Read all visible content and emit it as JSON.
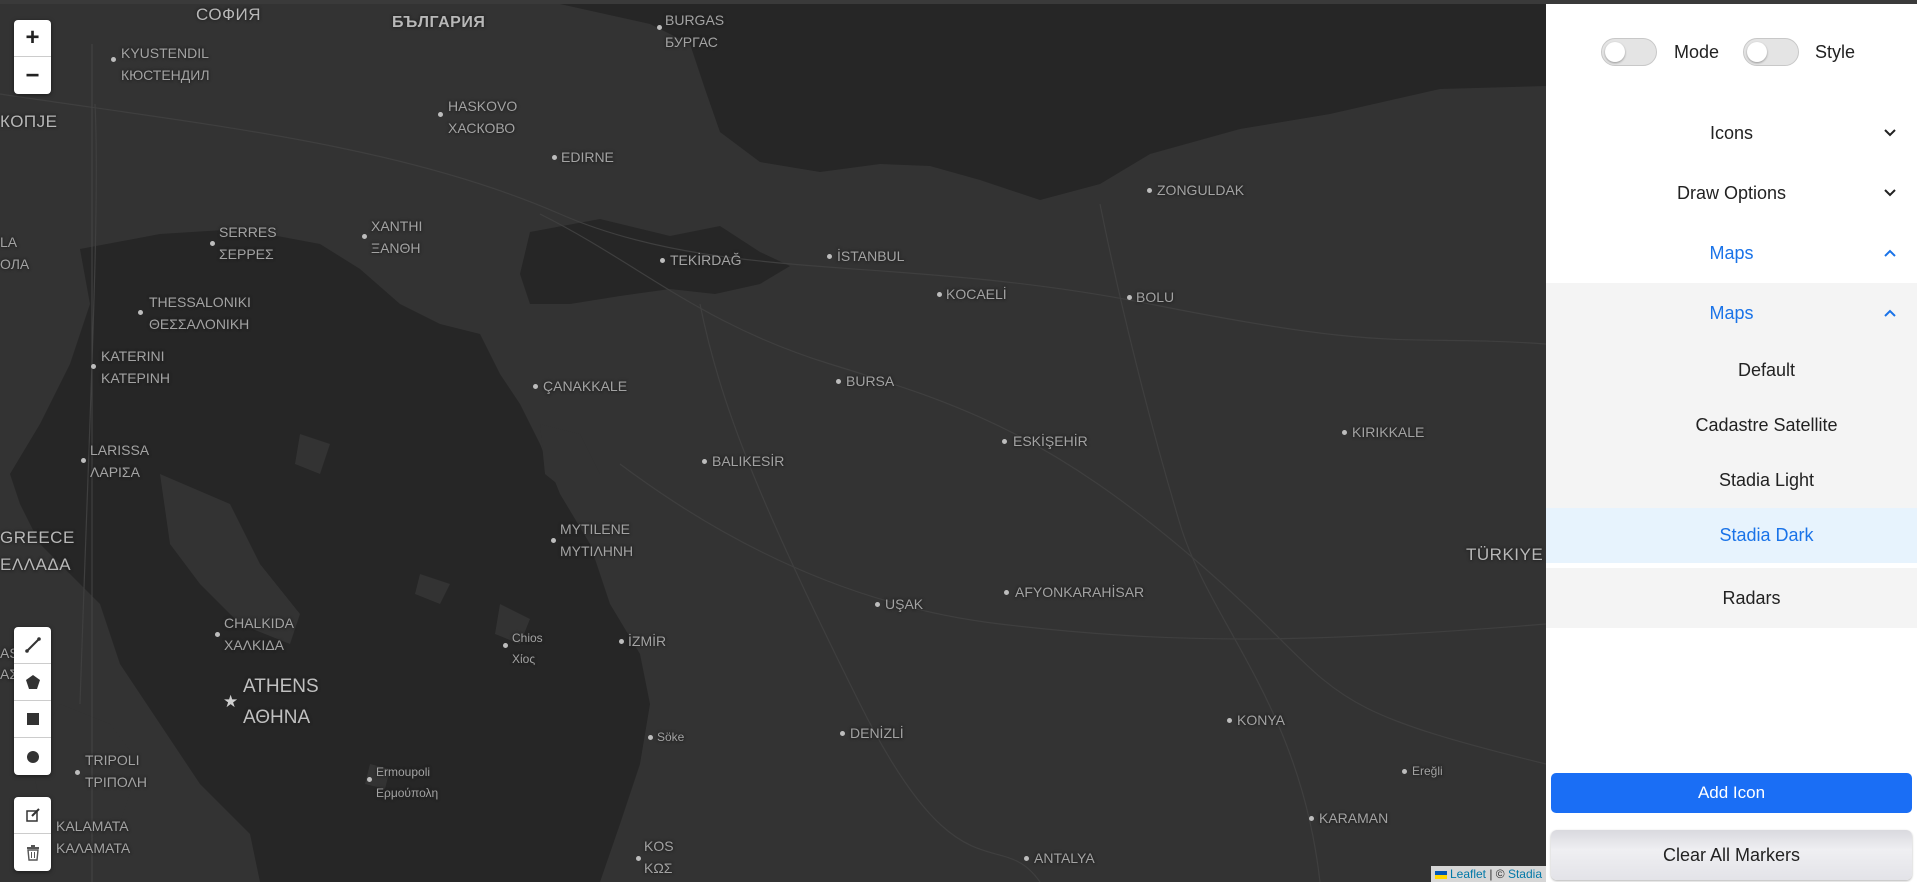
{
  "map": {
    "zoom_in": "+",
    "zoom_out": "−",
    "attribution": {
      "leaflet": "Leaflet",
      "separator": " | © ",
      "stadia": "Stadia"
    },
    "labels": {
      "sofia": "СОФИЯ",
      "bulgaria": "БЪЛГАРИЯ",
      "burgas": "BURGAS",
      "burgas_local": "БУРГАС",
      "kyustendil": "KYUSTENDIL",
      "kyustendil_local": "КЮСТЕНДИЛ",
      "skopje_part": "КОПЈЕ",
      "skopje_part2": "КОПЈЕ",
      "haskovo": "HASKOVO",
      "haskovo_local": "ХАСКОВО",
      "edirne": "EDIRNE",
      "zonguldak": "ZONGULDAK",
      "la": "LA",
      "ola": "ОЛА",
      "serres": "SERRES",
      "serres_local": "ΣΕΡΡΕΣ",
      "xanthi": "XANTHI",
      "xanthi_local": "ΞΑΝΘΗ",
      "tekirdag": "TEKİRDAĞ",
      "istanbul": "İSTANBUL",
      "kocaeli": "KOCAELİ",
      "bolu": "BOLU",
      "thessaloniki": "THESSALONIKI",
      "thessaloniki_local": "ΘΕΣΣΑΛΟΝΙΚΗ",
      "katerini": "KATERINI",
      "katerini_local": "ΚΑΤΕΡΙΝΗ",
      "canakkale": "ÇANAKKALE",
      "bursa": "BURSA",
      "balikesir": "BALIKESİR",
      "eskisehir": "ESKİŞEHİR",
      "kirikkale": "KIRIKKALE",
      "larissa": "LARISSA",
      "larissa_local": "ΛΑΡΙΣΑ",
      "mytilene": "MYTILENE",
      "mytilene_local": "ΜΥΤΙΛΗΝΗ",
      "greece": "GREECE",
      "ellada": "ΕΛΛΑΔΑ",
      "turkiye": "TÜRKIYE",
      "usak": "UŞAK",
      "afyon": "AFYONKARAHİSAR",
      "chalkida": "CHALKIDA",
      "chalkida_local": "ΧΑΛΚΙΔΑ",
      "chios": "Chios",
      "chios_local": "Χίος",
      "izmir": "İZMİR",
      "as": "AS",
      "as2": "ΑΣ",
      "athens": "ATHENS",
      "athens_local": "ΑΘΗΝΑ",
      "soke": "Söke",
      "denizli": "DENİZLİ",
      "konya": "KONYA",
      "tripoli": "TRIPOLI",
      "tripoli_local": "ΤΡΙΠΟΛΗ",
      "ermoupoli": "Ermoupoli",
      "ermoupoli_local": "Ερμούπολη",
      "eregli": "Ereğli",
      "karaman": "KARAMAN",
      "kalamata": "KALAMATA",
      "kalamata_local": "ΚΑΛΑΜΑΤΑ",
      "kos": "KOS",
      "kos_local": "ΚΩΣ",
      "antalya": "ANTALYA"
    }
  },
  "panel": {
    "mode_label": "Mode",
    "style_label": "Style",
    "icons_label": "Icons",
    "draw_options_label": "Draw Options",
    "maps_label": "Maps",
    "maps_sub_label": "Maps",
    "map_items": [
      "Default",
      "Cadastre Satellite",
      "Stadia Light",
      "Stadia Dark",
      "Radars"
    ],
    "add_icon_label": "Add Icon",
    "clear_markers_label": "Clear All Markers"
  },
  "colors": {
    "accent": "#1a73e8",
    "map_bg": "#333333",
    "water": "#252525",
    "primary_button": "#1a6ef5"
  }
}
